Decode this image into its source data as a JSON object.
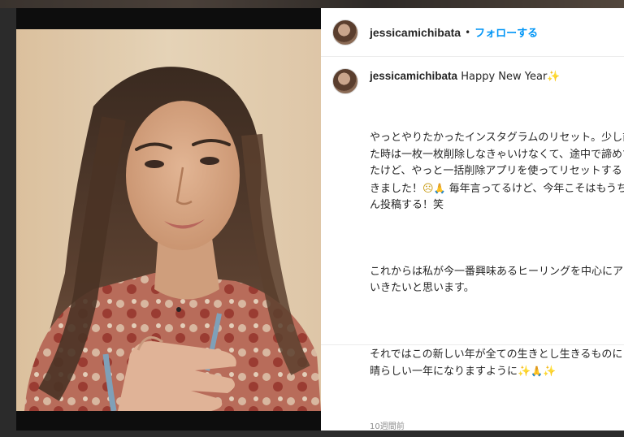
{
  "post": {
    "username": "jessicamichibata",
    "follow_label": "フォローする",
    "separator": "•",
    "caption_head": "Happy New Year",
    "paragraphs": [
      [
        "やっとやりたかったインスタグラムのリセット。少し前に消そうとし",
        "た時は一枚一枚削除しなきゃいけなくて、途中で諦めてしまっていまし",
        "たけど、やっと一括削除アプリを使ってリセットすることがで",
        "きました！",
        "毎年言ってるけど、今年こそはもうちょっとたくさ",
        "ん投稿する！笑"
      ],
      [
        "これからは私が今一番興味あるヒーリングを中心にアップして",
        "いきたいと思います。"
      ],
      [
        "それではこの新しい年が全ての生きとし生きるものにとって素",
        "晴らしい一年になりますように"
      ]
    ],
    "timestamp": "10週間前"
  },
  "icons": {
    "sparkle": "sparkle-icon",
    "pray": "pray-icon",
    "sad_face": "sad-face-icon"
  },
  "colors": {
    "link": "#0095f6",
    "text": "#262626",
    "muted": "#8e8e8e"
  }
}
